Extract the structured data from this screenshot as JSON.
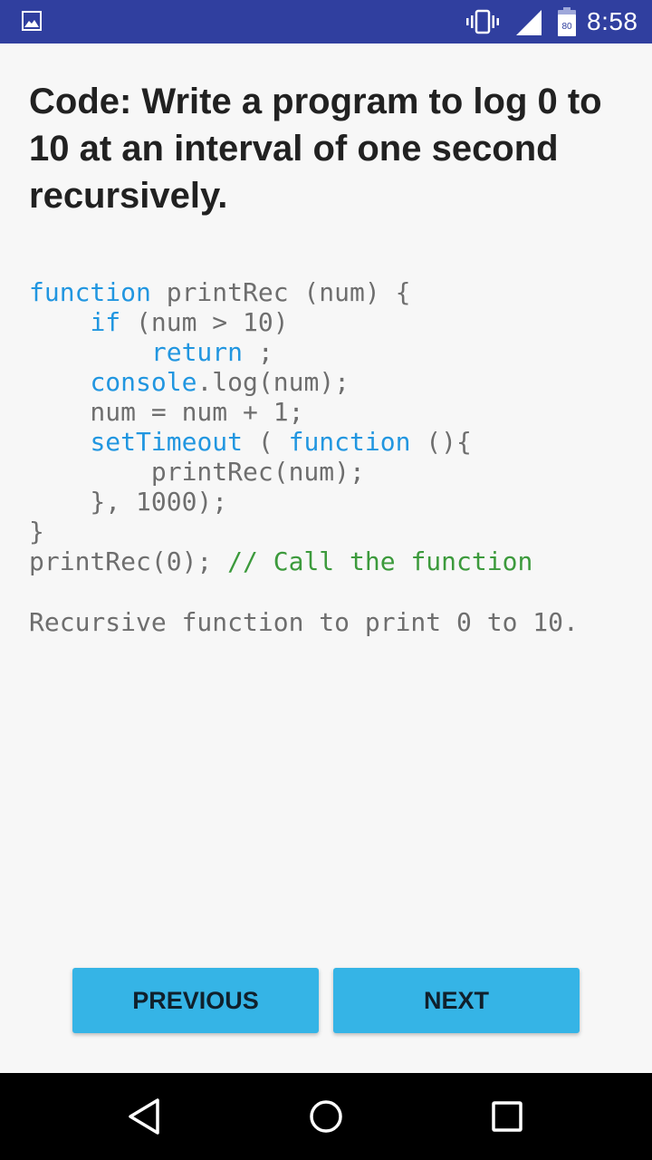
{
  "status_bar": {
    "time": "8:58",
    "battery_level": "80",
    "icons": [
      "image-notification-icon",
      "vibrate-icon",
      "signal-icon",
      "battery-icon"
    ]
  },
  "question": {
    "title": "Code: Write a program to log 0 to 10 at an interval of one second recursively."
  },
  "code": {
    "lines": [
      [
        {
          "t": "function",
          "c": "kw"
        },
        {
          "t": " printRec (num) {",
          "c": "tx"
        }
      ],
      [
        {
          "t": "    ",
          "c": "tx"
        },
        {
          "t": "if",
          "c": "kw"
        },
        {
          "t": " (num > 10)",
          "c": "tx"
        }
      ],
      [
        {
          "t": "        ",
          "c": "tx"
        },
        {
          "t": "return",
          "c": "kw"
        },
        {
          "t": " ;",
          "c": "tx"
        }
      ],
      [
        {
          "t": "    ",
          "c": "tx"
        },
        {
          "t": "console",
          "c": "kw"
        },
        {
          "t": ".log(num);",
          "c": "tx"
        }
      ],
      [
        {
          "t": "    num = num + 1;",
          "c": "tx"
        }
      ],
      [
        {
          "t": "    ",
          "c": "tx"
        },
        {
          "t": "setTimeout",
          "c": "kw"
        },
        {
          "t": " ( ",
          "c": "tx"
        },
        {
          "t": "function",
          "c": "kw"
        },
        {
          "t": " (){",
          "c": "tx"
        }
      ],
      [
        {
          "t": "        printRec(num);",
          "c": "tx"
        }
      ],
      [
        {
          "t": "    }, 1000);",
          "c": "tx"
        }
      ],
      [
        {
          "t": "}",
          "c": "tx"
        }
      ],
      [
        {
          "t": "printRec(0); ",
          "c": "tx"
        },
        {
          "t": "// Call the function",
          "c": "cm"
        }
      ]
    ],
    "description": "Recursive function to print 0 to 10."
  },
  "buttons": {
    "previous_label": "PREVIOUS",
    "next_label": "NEXT"
  },
  "colors": {
    "status_bar": "#303f9f",
    "button": "#35b4e6",
    "keyword": "#2196e0",
    "comment": "#3c9a3c"
  },
  "nav_bar": {
    "icons": [
      "back-icon",
      "home-icon",
      "recents-icon"
    ]
  }
}
